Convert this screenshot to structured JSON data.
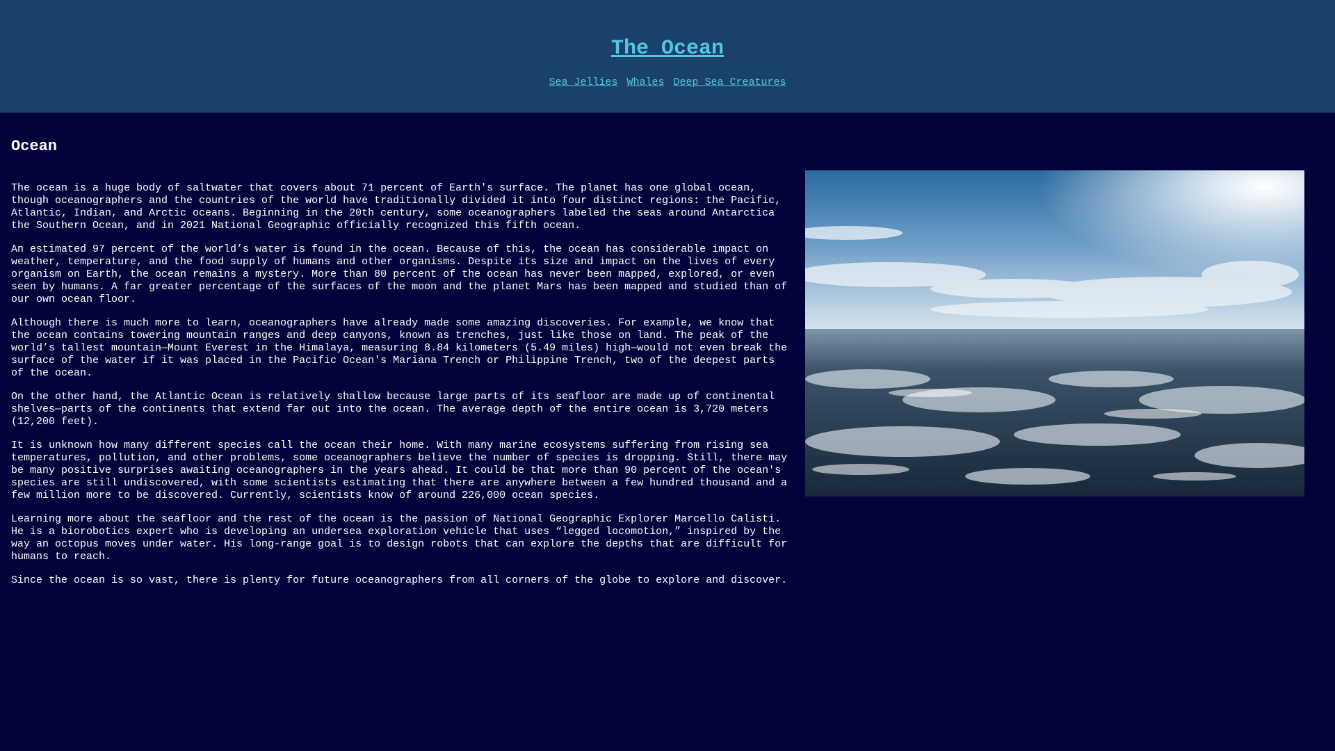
{
  "header": {
    "title": "The Ocean",
    "nav": [
      {
        "label": "Sea Jellies"
      },
      {
        "label": "Whales"
      },
      {
        "label": "Deep Sea Creatures"
      }
    ]
  },
  "main": {
    "heading": "Ocean",
    "paragraphs": [
      "The ocean is a huge body of saltwater that covers about 71 percent of Earth's surface. The planet has one global ocean, though oceanographers and the countries of the world have traditionally divided it into four distinct regions: the Pacific, Atlantic, Indian, and Arctic oceans. Beginning in the 20th century, some oceanographers labeled the seas around Antarctica the Southern Ocean, and in 2021 National Geographic officially recognized this fifth ocean.",
      "An estimated 97 percent of the world’s water is found in the ocean. Because of this, the ocean has considerable impact on weather, temperature, and the food supply of humans and other organisms. Despite its size and impact on the lives of every organism on Earth, the ocean remains a mystery. More than 80 percent of the ocean has never been mapped, explored, or even seen by humans. A far greater percentage of the surfaces of the moon and the planet Mars has been mapped and studied than of our own ocean floor.",
      "Although there is much more to learn, oceanographers have already made some amazing discoveries. For example, we know that the ocean contains towering mountain ranges and deep canyons, known as trenches, just like those on land. The peak of the world’s tallest mountain—Mount Everest in the Himalaya, measuring 8.84 kilometers (5.49 miles) high—would not even break the surface of the water if it was placed in the Pacific Ocean's Mariana Trench or Philippine Trench, two of the deepest parts of the ocean.",
      "On the other hand, the Atlantic Ocean is relatively shallow because large parts of its seafloor are made up of continental shelves—parts of the continents that extend far out into the ocean. The average depth of the entire ocean is 3,720 meters (12,200 feet).",
      "It is unknown how many different species call the ocean their home. With many marine ecosystems suffering from rising sea temperatures, pollution, and other problems, some oceanographers believe the number of species is dropping. Still, there may be many positive surprises awaiting oceanographers in the years ahead. It could be that more than 90 percent of the ocean's species are still undiscovered, with some scientists estimating that there are anywhere between a few hundred thousand and a few million more to be discovered. Currently, scientists know of around 226,000 ocean species.",
      "Learning more about the seafloor and the rest of the ocean is the passion of National Geographic Explorer Marcello Calisti. He is a biorobotics expert who is developing an undersea exploration vehicle that uses “legged locomotion,” inspired by the way an octopus moves under water. His long-range goal is to design robots that can explore the depths that are difficult for humans to reach.",
      "Since the ocean is so vast, there is plenty for future oceanographers from all corners of the globe to explore and discover."
    ]
  },
  "colors": {
    "header_bg": "#1a4169",
    "page_bg": "#02023a",
    "link": "#56c5e3",
    "text": "#ffffff"
  }
}
